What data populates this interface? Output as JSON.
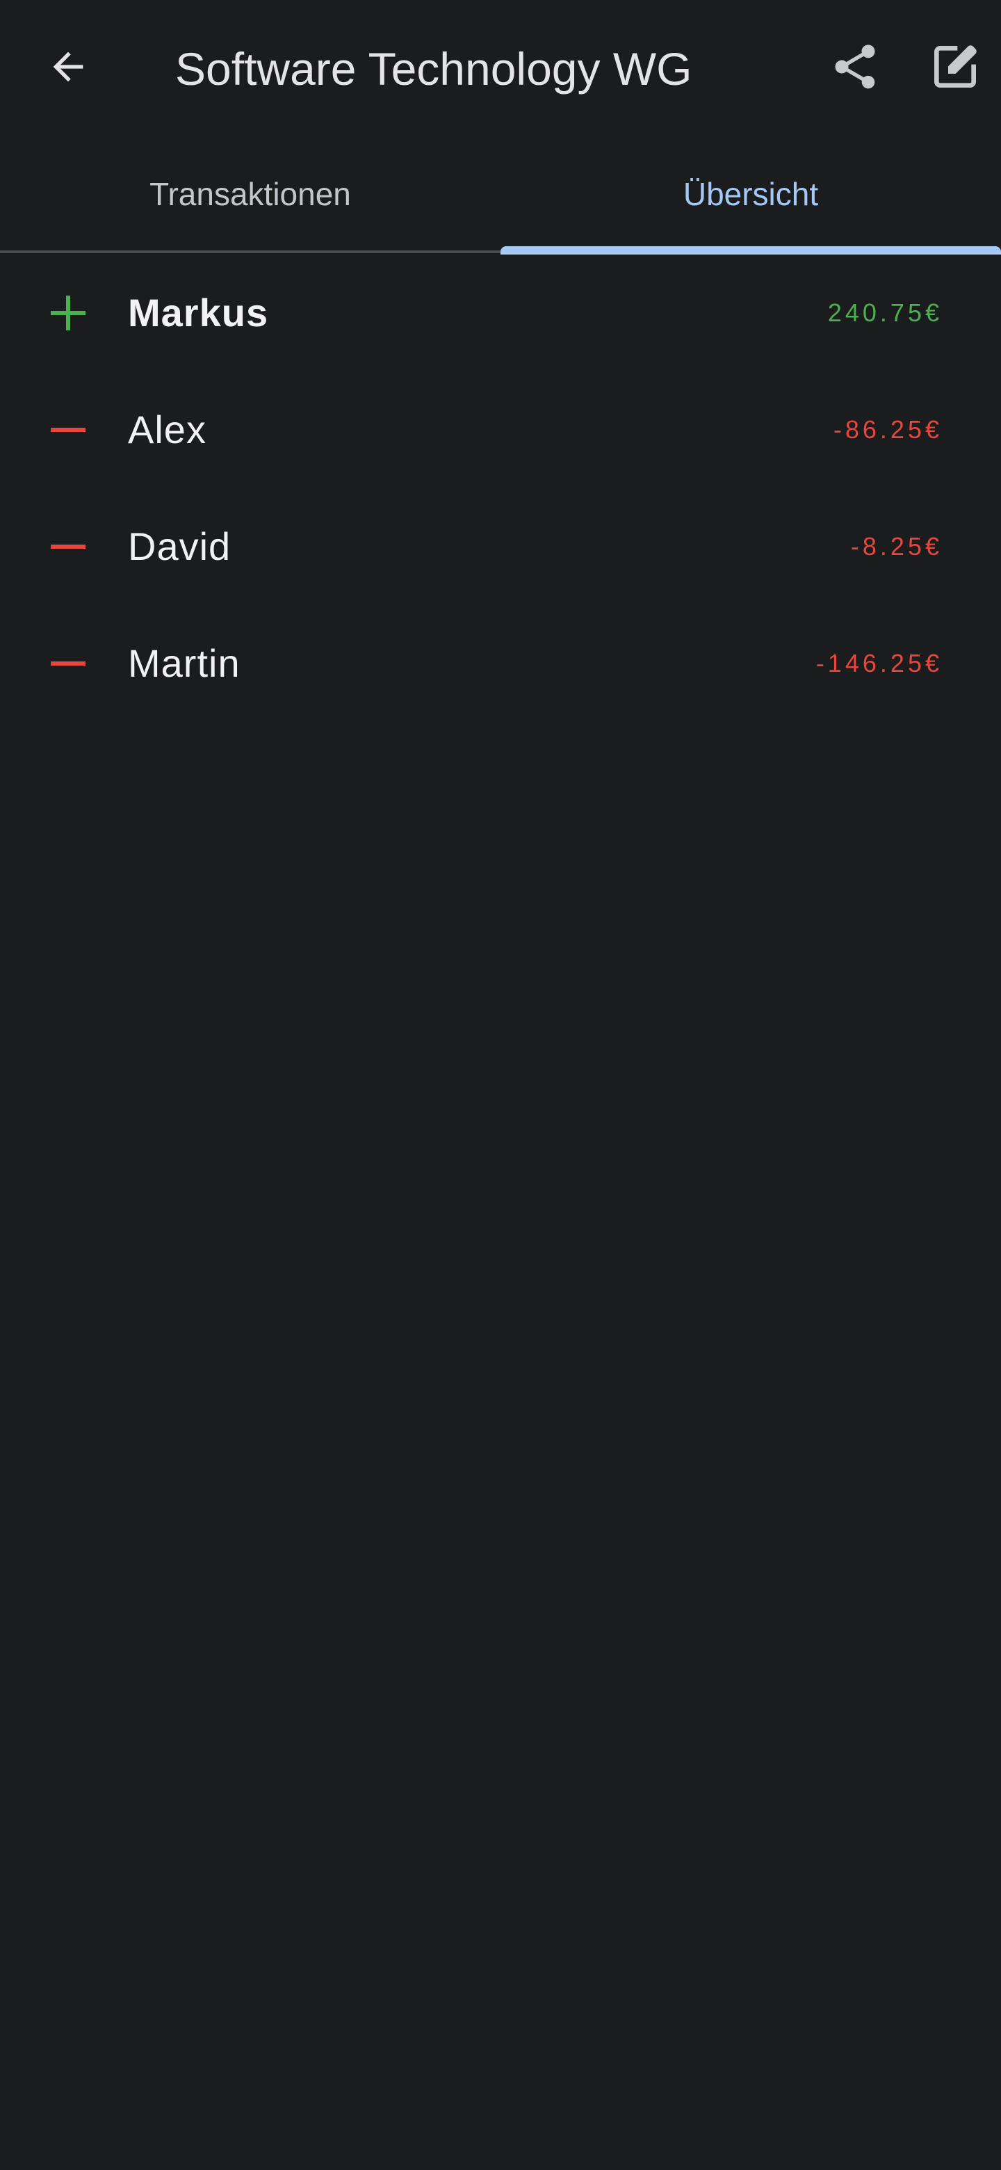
{
  "app_bar": {
    "title": "Software Technology WG",
    "back_icon": "arrow-left-icon",
    "share_icon": "share-icon",
    "edit_icon": "edit-note-icon"
  },
  "tabs": [
    {
      "label": "Transaktionen",
      "selected": false
    },
    {
      "label": "Übersicht",
      "selected": true
    }
  ],
  "balances": [
    {
      "name": "Markus",
      "amount": "240.75€",
      "sign": "plus",
      "emphasized": true
    },
    {
      "name": "Alex",
      "amount": "-86.25€",
      "sign": "minus",
      "emphasized": false
    },
    {
      "name": "David",
      "amount": "-8.25€",
      "sign": "minus",
      "emphasized": false
    },
    {
      "name": "Martin",
      "amount": "-146.25€",
      "sign": "minus",
      "emphasized": false
    }
  ],
  "colors": {
    "background": "#1b1c1e",
    "accent": "#a5c8f5",
    "positive": "#4caf50",
    "negative": "#e8453c"
  }
}
